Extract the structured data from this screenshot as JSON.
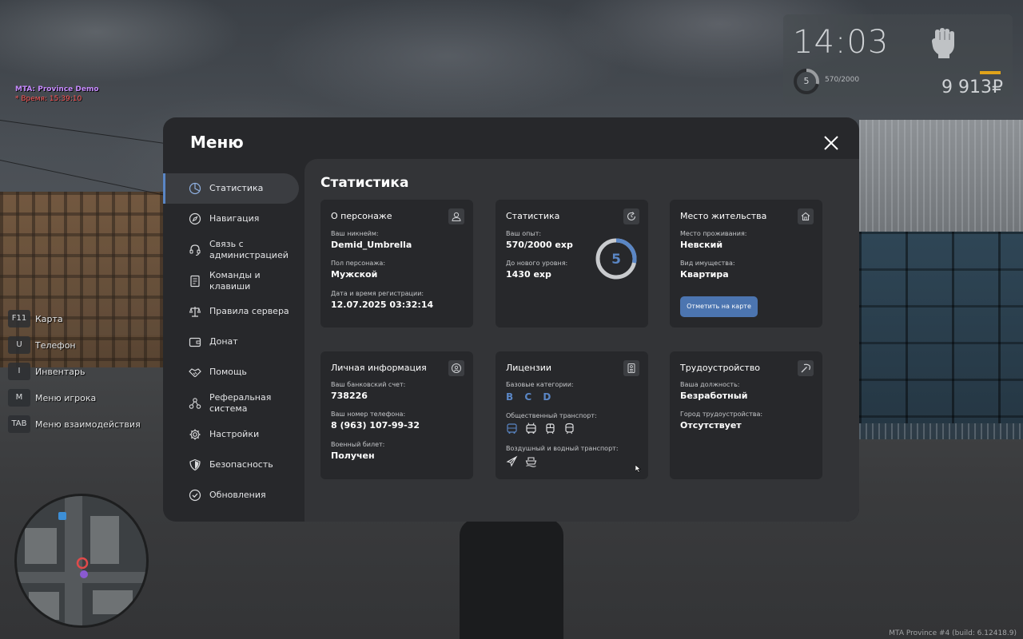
{
  "server": {
    "name": "MTA: Province Demo",
    "time": "* Время: 15:39:10"
  },
  "hud": {
    "time": "14:03",
    "level": "5",
    "exp": "570/2000",
    "exp_fraction": 0.285,
    "money": "9 913₽",
    "colors": {
      "bar": "#e0a31a"
    }
  },
  "hints": [
    {
      "key": "F11",
      "label": "Карта"
    },
    {
      "key": "U",
      "label": "Телефон"
    },
    {
      "key": "I",
      "label": "Инвентарь"
    },
    {
      "key": "M",
      "label": "Меню игрока"
    },
    {
      "key": "TAB",
      "label": "Меню взаимодействия"
    }
  ],
  "menu": {
    "title": "Меню",
    "sidebar": [
      {
        "label": "Статистика",
        "icon": "pie-chart-icon",
        "active": true
      },
      {
        "label": "Навигация",
        "icon": "compass-icon"
      },
      {
        "label": "Связь с администрацией",
        "icon": "headset-icon"
      },
      {
        "label": "Команды и клавиши",
        "icon": "document-icon"
      },
      {
        "label": "Правила сервера",
        "icon": "scales-icon"
      },
      {
        "label": "Донат",
        "icon": "wallet-icon"
      },
      {
        "label": "Помощь",
        "icon": "handshake-icon"
      },
      {
        "label": "Реферальная система",
        "icon": "network-icon"
      },
      {
        "label": "Настройки",
        "icon": "gear-icon"
      },
      {
        "label": "Безопасность",
        "icon": "shield-icon"
      },
      {
        "label": "Обновления",
        "icon": "check-circle-icon"
      }
    ],
    "content_title": "Статистика",
    "cards": {
      "character": {
        "title": "О персонаже",
        "nick_label": "Ваш никнейм:",
        "nick": "Demid_Umbrella",
        "gender_label": "Пол персонажа:",
        "gender": "Мужской",
        "reg_label": "Дата и время регистрации:",
        "reg": "12.07.2025 03:32:14"
      },
      "stats": {
        "title": "Статистика",
        "exp_label": "Ваш опыт:",
        "exp": "570/2000 exp",
        "next_label": "До нового уровня:",
        "next": "1430 exp",
        "level": "5",
        "progress": 0.285
      },
      "residence": {
        "title": "Место жительства",
        "place_label": "Место проживания:",
        "place": "Невский",
        "property_label": "Вид имущества:",
        "property": "Квартира",
        "button": "Отметить на карте"
      },
      "personal": {
        "title": "Личная информация",
        "bank_label": "Ваш банковский счет:",
        "bank": "738226",
        "phone_label": "Ваш номер телефона:",
        "phone": "8 (963) 107-99-32",
        "military_label": "Военный билет:",
        "military": "Получен"
      },
      "licenses": {
        "title": "Лицензии",
        "base_label": "Базовые категории:",
        "categories": [
          "B",
          "C",
          "D"
        ],
        "public_label": "Общественный транспорт:",
        "air_label": "Воздушный и водный транспорт:"
      },
      "job": {
        "title": "Трудоустройство",
        "position_label": "Ваша должность:",
        "position": "Безработный",
        "city_label": "Город трудоустройства:",
        "city": "Отсутствует"
      }
    }
  },
  "build": "MTA Province #4 (build: 6.12418.9)",
  "colors": {
    "accent": "#5a86c5",
    "panel": "#27282b",
    "content": "#333437",
    "button": "#4c75b0"
  }
}
